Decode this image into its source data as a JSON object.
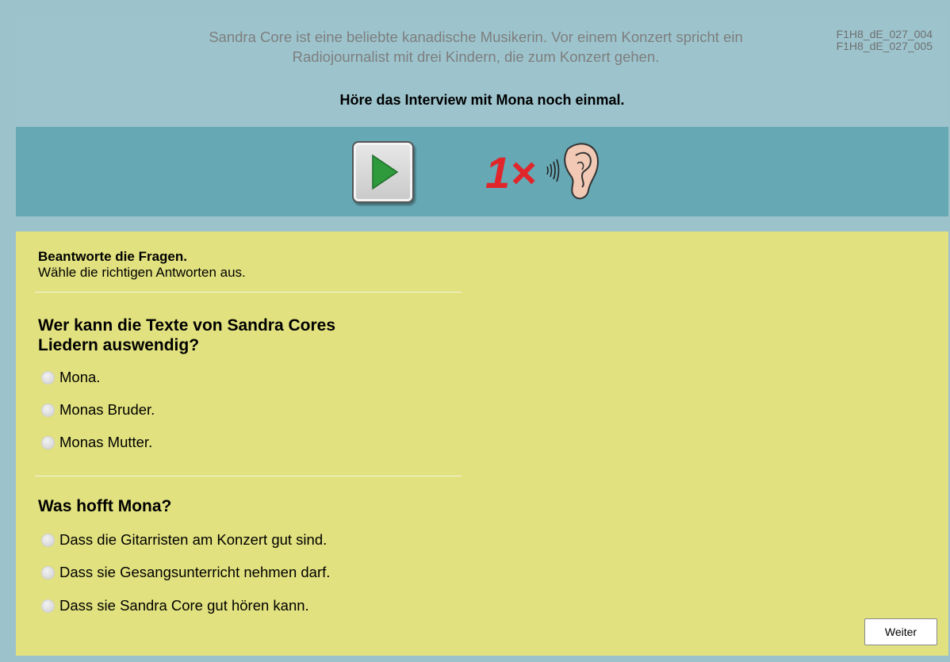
{
  "header": {
    "intro_line1": "Sandra Core ist eine beliebte kanadische Musikerin. Vor einem Konzert spricht ein",
    "intro_line2": "Radiojournalist mit drei Kindern, die zum Konzert gehen.",
    "codes": [
      "F1H8_dE_027_004",
      "F1H8_dE_027_005"
    ],
    "instruction": "Höre das Interview mit Mona noch einmal."
  },
  "media": {
    "play_icon": "play-icon",
    "limit_text": "1×",
    "limit_icon": "ear-icon",
    "colors": {
      "play": "#2e9a3c",
      "limit": "#e0262b"
    }
  },
  "task": {
    "title": "Beantworte die Fragen.",
    "subtitle": "Wähle die richtigen Antworten aus."
  },
  "questions": [
    {
      "text_line1": "Wer kann die Texte von Sandra Cores",
      "text_line2": "Liedern auswendig?",
      "options": [
        "Mona.",
        "Monas Bruder.",
        "Monas Mutter."
      ]
    },
    {
      "text_line1": "Was hofft Mona?",
      "options": [
        "Dass die Gitarristen am Konzert gut sind.",
        "Dass sie Gesangsunterricht nehmen darf.",
        "Dass sie Sandra Core gut hören kann."
      ]
    }
  ],
  "footer": {
    "next_label": "Weiter"
  }
}
